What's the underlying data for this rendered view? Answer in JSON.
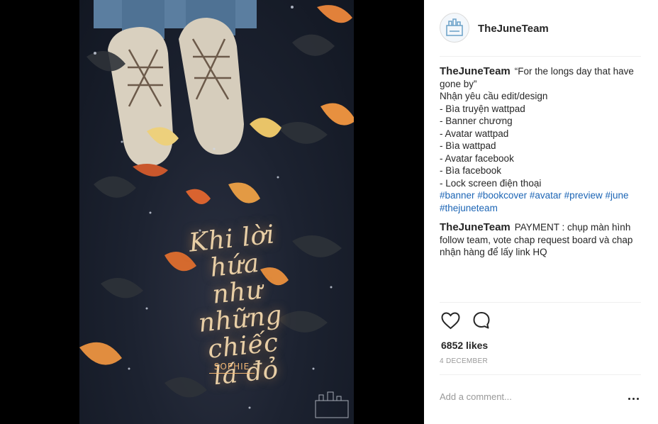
{
  "post": {
    "username": "TheJuneTeam",
    "poster": {
      "title_lines": [
        "Khi lời",
        "hứa như",
        "những",
        "chiếc",
        "lá đỏ"
      ],
      "author": "SOPHIE"
    }
  },
  "caption": {
    "username": "TheJuneTeam",
    "lines": [
      "“For the longs day that have gone by”",
      "Nhận yêu cầu edit/design",
      "- Bìa truyện wattpad",
      "- Banner chương",
      "- Avatar wattpad",
      "- Bìa wattpad",
      "- Avatar facebook",
      "- Bìa facebook",
      "- Lock screen điện thoại"
    ],
    "hashtags": [
      "#banner",
      "#bookcover",
      "#avatar",
      "#preview",
      "#june",
      "#thejuneteam"
    ]
  },
  "reply": {
    "username": "TheJuneTeam",
    "text": "PAYMENT : chụp màn hình follow team, vote chap request board và chap nhận hàng để lấy link HQ"
  },
  "actions": {
    "like_icon": "heart-icon",
    "comment_icon": "comment-bubble-icon"
  },
  "likes": "6852 likes",
  "date": "4 DECEMBER",
  "comment_box": {
    "placeholder": "Add a comment..."
  },
  "colors": {
    "hashtag": "#1c65b5",
    "text": "#262626",
    "muted": "#999999",
    "poster_bg": "#1c2230",
    "leaf_orange": "#e1813a",
    "leaf_yellow": "#e9c468"
  }
}
